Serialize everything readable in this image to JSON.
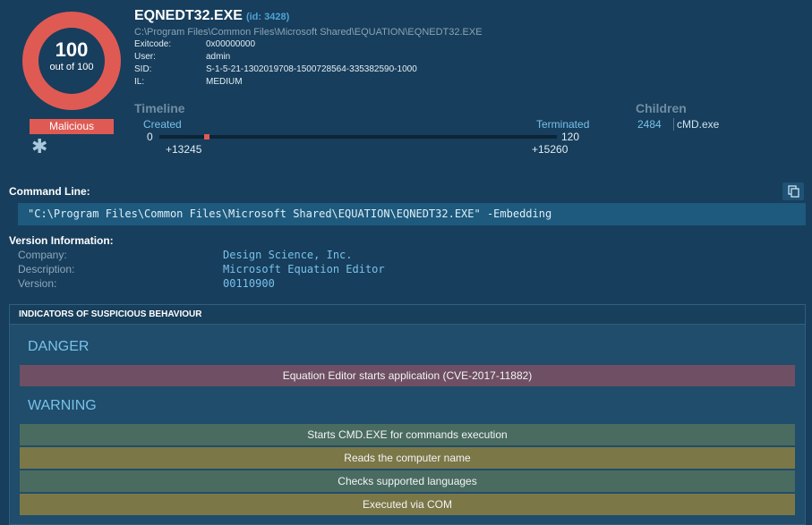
{
  "score": {
    "value": "100",
    "label": "out of 100",
    "verdict": "Malicious",
    "ring_color": "#e05a54"
  },
  "process": {
    "name": "EQNEDT32.EXE",
    "id_label": "(id: 3428)",
    "path": "C:\\Program Files\\Common Files\\Microsoft Shared\\EQUATION\\EQNEDT32.EXE",
    "details": [
      {
        "key": "Exitcode:",
        "value": "0x00000000"
      },
      {
        "key": "User:",
        "value": "admin"
      },
      {
        "key": "SID:",
        "value": "S-1-5-21-1302019708-1500728564-335382590-1000"
      },
      {
        "key": "IL:",
        "value": "MEDIUM"
      }
    ]
  },
  "timeline": {
    "heading": "Timeline",
    "created_label": "Created",
    "terminated_label": "Terminated",
    "start": "0",
    "end": "120",
    "created_time": "+13245",
    "terminated_time": "+15260"
  },
  "children": {
    "heading": "Children",
    "items": [
      {
        "pid": "2484",
        "name": "cMD.exe"
      }
    ]
  },
  "command_line": {
    "label": "Command Line:",
    "value": "\"C:\\Program Files\\Common Files\\Microsoft Shared\\EQUATION\\EQNEDT32.EXE\" -Embedding",
    "copy_icon": "copy-icon"
  },
  "version_info": {
    "label": "Version Information:",
    "rows": [
      {
        "key": "Company:",
        "value": "Design Science, Inc."
      },
      {
        "key": "Description:",
        "value": "Microsoft Equation Editor"
      },
      {
        "key": "Version:",
        "value": "00110900"
      }
    ]
  },
  "indicators": {
    "title": "INDICATORS OF SUSPICIOUS BEHAVIOUR",
    "danger_label": "DANGER",
    "danger": [
      "Equation Editor starts application (CVE-2017-11882)"
    ],
    "warning_label": "WARNING",
    "warning": [
      "Starts CMD.EXE for commands execution",
      "Reads the computer name",
      "Checks supported languages",
      "Executed via COM"
    ]
  }
}
